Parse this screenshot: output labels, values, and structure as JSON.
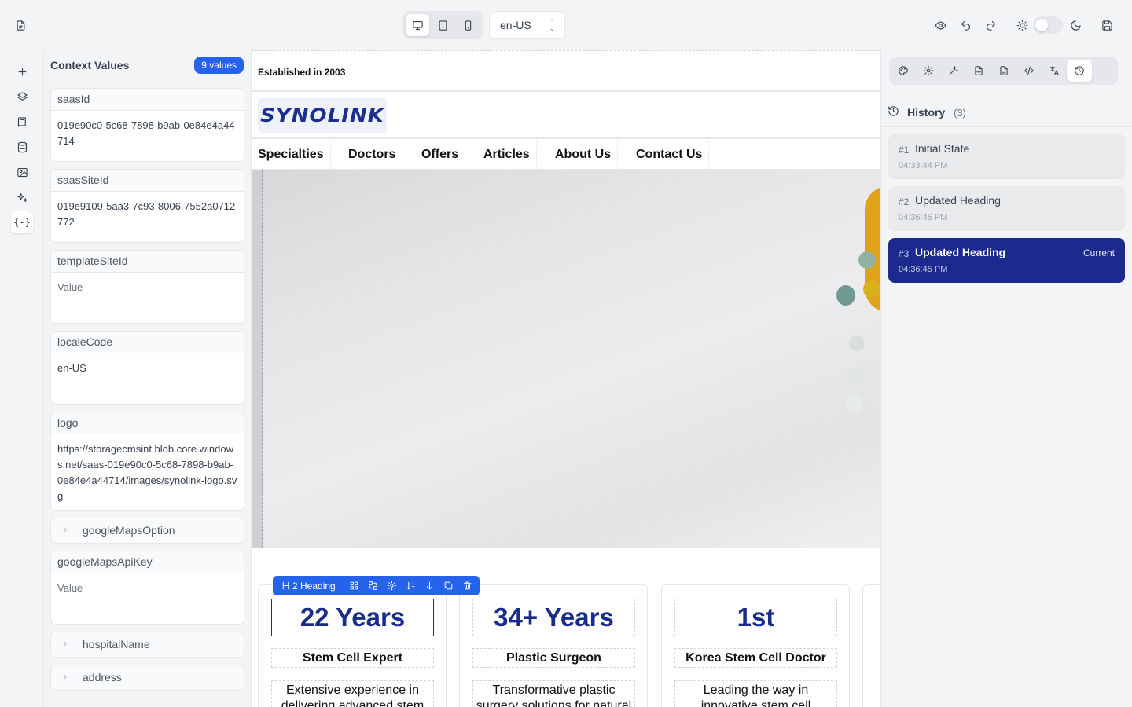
{
  "topbar": {
    "locale": "en-US"
  },
  "context": {
    "title": "Context Values",
    "count": "9 values",
    "fields": {
      "saasId": {
        "label": "saasId",
        "value": "019e90c0-5c68-7898-b9ab-0e84e4a44714"
      },
      "saasSiteId": {
        "label": "saasSiteId",
        "value": "019e9109-5aa3-7c93-8006-7552a0712772"
      },
      "templateSiteId": {
        "label": "templateSiteId",
        "value": "Value"
      },
      "localeCode": {
        "label": "localeCode",
        "value": "en-US"
      },
      "logo": {
        "label": "logo",
        "value": "https://storagecmsint.blob.core.windows.net/saas-019e90c0-5c68-7898-b9ab-0e84e4a44714/images/synolink-logo.svg"
      },
      "googleMapsOption": {
        "label": "googleMapsOption"
      },
      "googleMapsApiKey": {
        "label": "googleMapsApiKey",
        "value": "Value"
      },
      "hospitalName": {
        "label": "hospitalName"
      },
      "address": {
        "label": "address"
      }
    }
  },
  "canvas": {
    "established": "Established in 2003",
    "logo_text": "SYNOLINK",
    "nav": [
      "Specialties",
      "Doctors",
      "Offers",
      "Articles",
      "About Us",
      "Contact Us"
    ],
    "selection_tag": "2 Heading",
    "cards": [
      {
        "years": "22 Years",
        "title": "Stem Cell Expert",
        "desc": "Extensive experience in delivering advanced stem"
      },
      {
        "years": "34+ Years",
        "title": "Plastic Surgeon",
        "desc": "Transformative plastic surgery solutions for natural"
      },
      {
        "years": "1st",
        "title": "Korea Stem Cell Doctor",
        "desc": "Leading the way in innovative stem cell"
      }
    ]
  },
  "history": {
    "title": "History",
    "count": "(3)",
    "items": [
      {
        "num": "#1",
        "name": "Initial State",
        "time": "04:33:44 PM"
      },
      {
        "num": "#2",
        "name": "Updated Heading",
        "time": "04:36:45 PM"
      },
      {
        "num": "#3",
        "name": "Updated Heading",
        "time": "04:36:45 PM",
        "badge": "Current"
      }
    ]
  },
  "colors": {
    "accent": "#2563eb",
    "brand_navy": "#1b2a8c"
  }
}
